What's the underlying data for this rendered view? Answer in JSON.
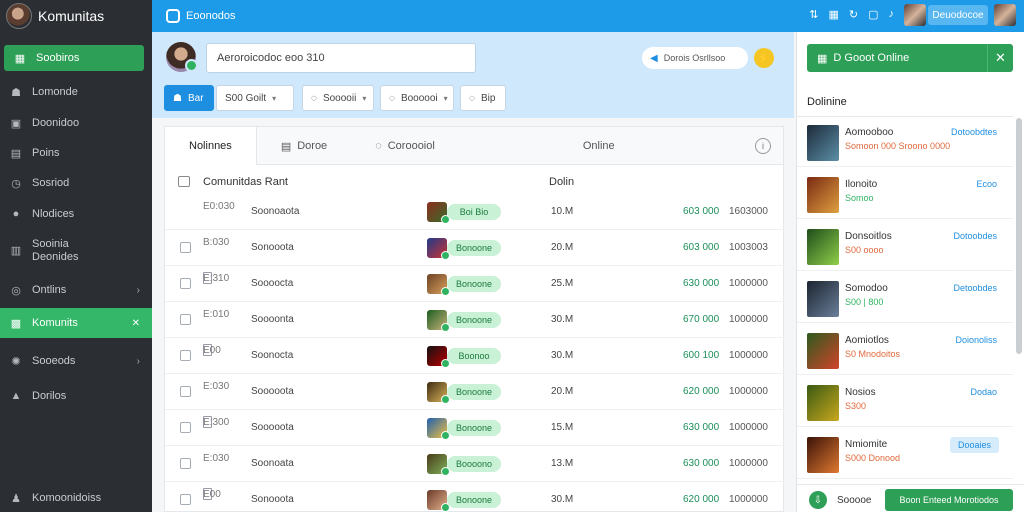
{
  "app": {
    "title": "Komunitas"
  },
  "sidebar": {
    "items": [
      {
        "label": "Soobiros",
        "icon": "grid-icon"
      },
      {
        "label": "Lomonde",
        "icon": "people-icon"
      },
      {
        "label": "Doonidoo",
        "icon": "chart-icon"
      },
      {
        "label": "Poins",
        "icon": "calendar-icon"
      },
      {
        "label": "Sosriod",
        "icon": "clock-icon"
      },
      {
        "label": "Nlodices",
        "icon": "bell-icon"
      },
      {
        "label": "Sooinia\nDeonides",
        "icon": "lock-icon"
      },
      {
        "label": "Ontlins",
        "icon": "globe-icon"
      },
      {
        "label": "Komunits",
        "icon": "community-icon"
      },
      {
        "label": "Sooeods",
        "icon": "gear-icon"
      },
      {
        "label": "Dorilos",
        "icon": "pin-icon"
      },
      {
        "label": "Komoonidoiss",
        "icon": "people-icon"
      }
    ]
  },
  "topbar": {
    "title": "Eoonodos",
    "button": "Deuodocoe"
  },
  "header": {
    "search_value": "Aeroroicodoc eoo 310",
    "pill_label": "Dorois Osrllsoo",
    "filters": [
      {
        "label": "Bar"
      },
      {
        "label": "S00 Goilt"
      },
      {
        "label": "Sooooii"
      },
      {
        "label": "Boooooi"
      },
      {
        "label": "Bip"
      }
    ]
  },
  "tabs": [
    {
      "label": "Nolinnes"
    },
    {
      "label": "Doroe"
    },
    {
      "label": "Coroooiol"
    },
    {
      "label": "Online"
    }
  ],
  "table": {
    "title": "Comunitdas Rant",
    "col_online": "Dolin",
    "rows": [
      {
        "code": "E0:030",
        "name": "Soonoaota",
        "badge": "Boi Bio",
        "size": "10.M",
        "price": "603 000",
        "stamp": "1603000"
      },
      {
        "code": "B:030",
        "name": "Sonooota",
        "badge": "Bonoone",
        "size": "20.M",
        "price": "603 000",
        "stamp": "1003003"
      },
      {
        "code": "E:310",
        "name": "Soooocta",
        "badge": "Bonoone",
        "size": "25.M",
        "price": "630 000",
        "stamp": "1000000"
      },
      {
        "code": "E:010",
        "name": "Soooonta",
        "badge": "Bonoone",
        "size": "30.M",
        "price": "670 000",
        "stamp": "1000000"
      },
      {
        "code": "E00",
        "name": "Soonocta",
        "badge": "Boonoo",
        "size": "30.M",
        "price": "600 100",
        "stamp": "1000000"
      },
      {
        "code": "E:030",
        "name": "Sooooota",
        "badge": "Bonoone",
        "size": "20.M",
        "price": "620 000",
        "stamp": "1000000"
      },
      {
        "code": "E:300",
        "name": "Sooooota",
        "badge": "Bonoone",
        "size": "15.M",
        "price": "630 000",
        "stamp": "1000000"
      },
      {
        "code": "E:030",
        "name": "Soonoata",
        "badge": "Boooono",
        "size": "13.M",
        "price": "630 000",
        "stamp": "1000000"
      },
      {
        "code": "E00",
        "name": "Sonooota",
        "badge": "Bonoone",
        "size": "30.M",
        "price": "620 000",
        "stamp": "1000000"
      }
    ]
  },
  "right_panel": {
    "button": "D Gooot Online",
    "heading": "Dolinine",
    "items": [
      {
        "name": "Aomooboo",
        "sub": "Somoon 000 Sroono 0000",
        "sub_color": "#e06a3c",
        "link": "Dotoobdtes"
      },
      {
        "name": "Ilonoito",
        "sub": "Somoo",
        "sub_color": "#2fb360",
        "link": "Ecoo"
      },
      {
        "name": "Donsoitlos",
        "sub": "S00 oooo",
        "sub_color": "#e06a3c",
        "link": "Dotoobdes"
      },
      {
        "name": "Somodoo",
        "sub": "S00 | 800",
        "sub_color": "#2fb360",
        "link": "Detoobdes"
      },
      {
        "name": "Aomiotlos",
        "sub": "S0 Mnodoitos",
        "sub_color": "#e06a3c",
        "link": "Doionoliss"
      },
      {
        "name": "Nosios",
        "sub": "S300",
        "sub_color": "#e06a3c",
        "link": "Dodao"
      },
      {
        "name": "Nmiomite",
        "sub": "S000 Donood",
        "sub_color": "#e06a3c",
        "link": "Dooaies"
      }
    ],
    "footer_label": "Sooooe",
    "footer_button": "Boon Enteed Morotiodos"
  }
}
